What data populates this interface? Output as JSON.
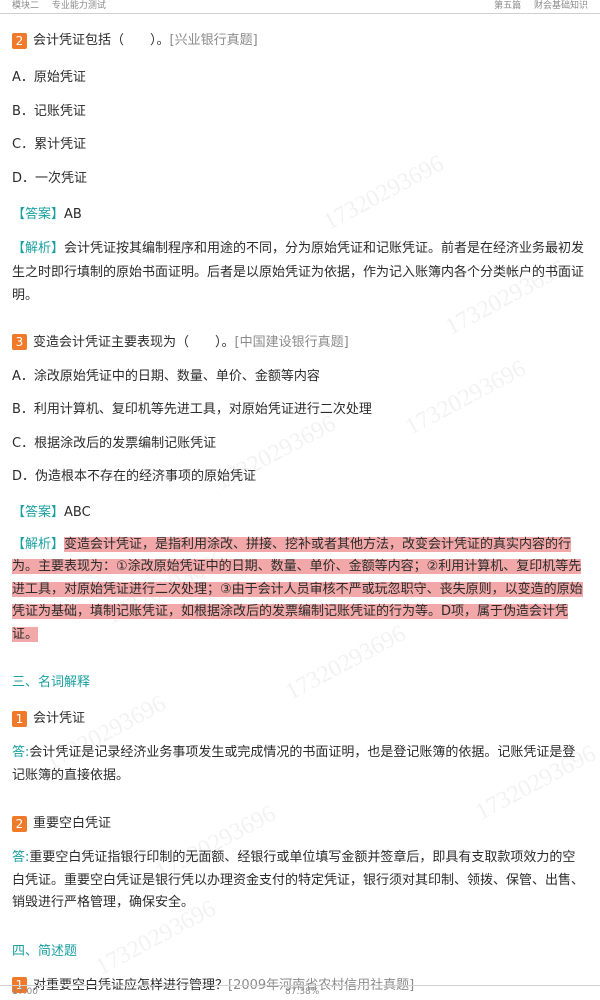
{
  "header": {
    "left_module": "模块二",
    "left_title": "专业能力测试",
    "right_part": "第五篇",
    "right_title": "财会基础知识"
  },
  "watermark": "17320293696",
  "q2": {
    "num": "2",
    "text": "会计凭证包括（　　）。",
    "source": "[兴业银行真题]",
    "options": [
      "A．原始凭证",
      "B．记账凭证",
      "C．累计凭证",
      "D．一次凭证"
    ],
    "answer_tag": "【答案】",
    "answer": "AB",
    "analysis_tag": "【解析】",
    "analysis": "会计凭证按其编制程序和用途的不同，分为原始凭证和记账凭证。前者是在经济业务最初发生之时即行填制的原始书面证明。后者是以原始凭证为依据，作为记入账簿内各个分类帐户的书面证明。"
  },
  "q3": {
    "num": "3",
    "text": "变造会计凭证主要表现为（　　）。",
    "source": "[中国建设银行真题]",
    "options": [
      "A．涂改原始凭证中的日期、数量、单价、金额等内容",
      "B．利用计算机、复印机等先进工具，对原始凭证进行二次处理",
      "C．根据涂改后的发票编制记账凭证",
      "D．伪造根本不存在的经济事项的原始凭证"
    ],
    "answer_tag": "【答案】",
    "answer": "ABC",
    "analysis_tag": "【解析】",
    "analysis": "变造会计凭证，是指利用涂改、拼接、挖补或者其他方法，改变会计凭证的真实内容的行为。主要表现为：①涂改原始凭证中的日期、数量、单价、金额等内容；②利用计算机、复印机等先进工具，对原始凭证进行二次处理；③由于会计人员审核不严或玩忽职守、丧失原则，以变造的原始凭证为基础，填制记账凭证，如根据涂改后的发票编制记账凭证的行为等。D项，属于伪造会计凭证。"
  },
  "section3": {
    "title": "三、名词解释",
    "items": [
      {
        "num": "1",
        "term": "会计凭证",
        "answer_tag": "答:",
        "answer": "会计凭证是记录经济业务事项发生或完成情况的书面证明，也是登记账簿的依据。记账凭证是登记账簿的直接依据。"
      },
      {
        "num": "2",
        "term": "重要空白凭证",
        "answer_tag": "答:",
        "answer": "重要空白凭证指银行印制的无面额、经银行或单位填写金额并签章后，即具有支取款项效力的空白凭证。重要空白凭证是银行凭以办理资金支付的特定凭证，银行须对其印制、领拨、保管、出售、销毁进行严格管理，确保安全。"
      }
    ]
  },
  "section4": {
    "title": "四、简述题",
    "item1": {
      "num": "1",
      "text": "对重要空白凭证应怎样进行管理？",
      "source": "[2009年河南省农村信用社真题]"
    }
  },
  "footer": {
    "time": "17:00",
    "zoom": "87.38%"
  }
}
